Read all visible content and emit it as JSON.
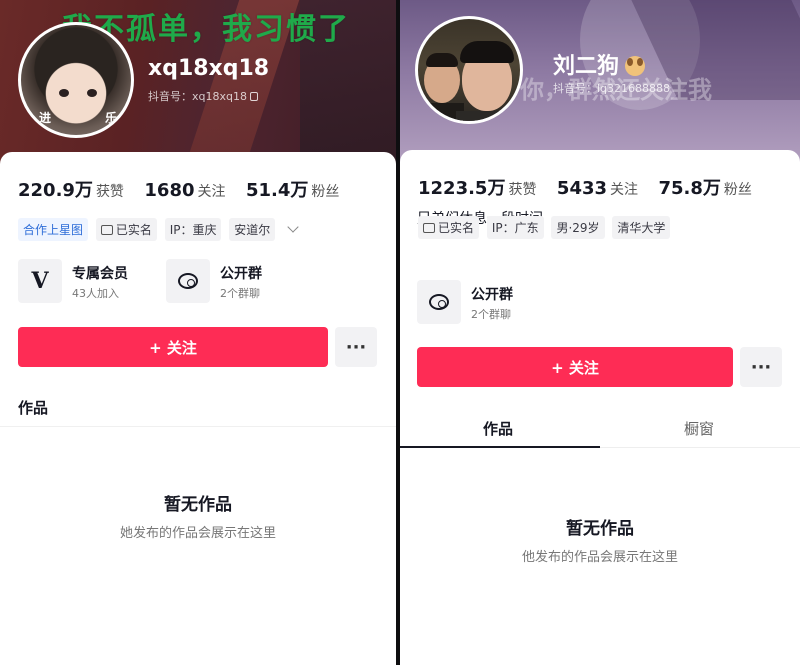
{
  "left": {
    "banner_text": "我不孤单，我习惯了",
    "avatar_caption_left": "进",
    "avatar_caption_right": "乐",
    "username": "xq18xq18",
    "douyin_id": "抖音号：xq18xq18",
    "stats": [
      {
        "value": "220.9万",
        "label": "获赞"
      },
      {
        "value": "1680",
        "label": "关注"
      },
      {
        "value": "51.4万",
        "label": "粉丝"
      }
    ],
    "tags": [
      "合作上星图",
      "已实名",
      "IP：重庆",
      "安道尔"
    ],
    "features": [
      {
        "title": "专属会员",
        "subtitle": "43人加入",
        "icon": "v-icon"
      },
      {
        "title": "公开群",
        "subtitle": "2个群聊",
        "icon": "chat-icon"
      }
    ],
    "follow_label": "+ 关注",
    "more_label": "···",
    "works_label": "作品",
    "empty_title": "暂无作品",
    "empty_subtitle": "她发布的作品会展示在这里"
  },
  "right": {
    "overlay_text": "你，群然还关注我",
    "username": "刘二狗",
    "douyin_id": "抖音号：lq321688888",
    "stats": [
      {
        "value": "1223.5万",
        "label": "获赞"
      },
      {
        "value": "5433",
        "label": "关注"
      },
      {
        "value": "75.8万",
        "label": "粉丝"
      }
    ],
    "bio": "兄弟们休息一段时间",
    "tags": [
      "已实名",
      "IP：广东",
      "男·29岁",
      "清华大学"
    ],
    "features": [
      {
        "title": "公开群",
        "subtitle": "2个群聊",
        "icon": "chat-icon"
      }
    ],
    "follow_label": "+ 关注",
    "more_label": "···",
    "tabs": [
      {
        "label": "作品",
        "active": true
      },
      {
        "label": "橱窗",
        "active": false
      }
    ],
    "empty_title": "暂无作品",
    "empty_subtitle": "他发布的作品会展示在这里"
  },
  "colors": {
    "follow_button": "#fe2c55",
    "banner_text": "#1faa4a",
    "tag_blue": "#2f6ed8"
  }
}
